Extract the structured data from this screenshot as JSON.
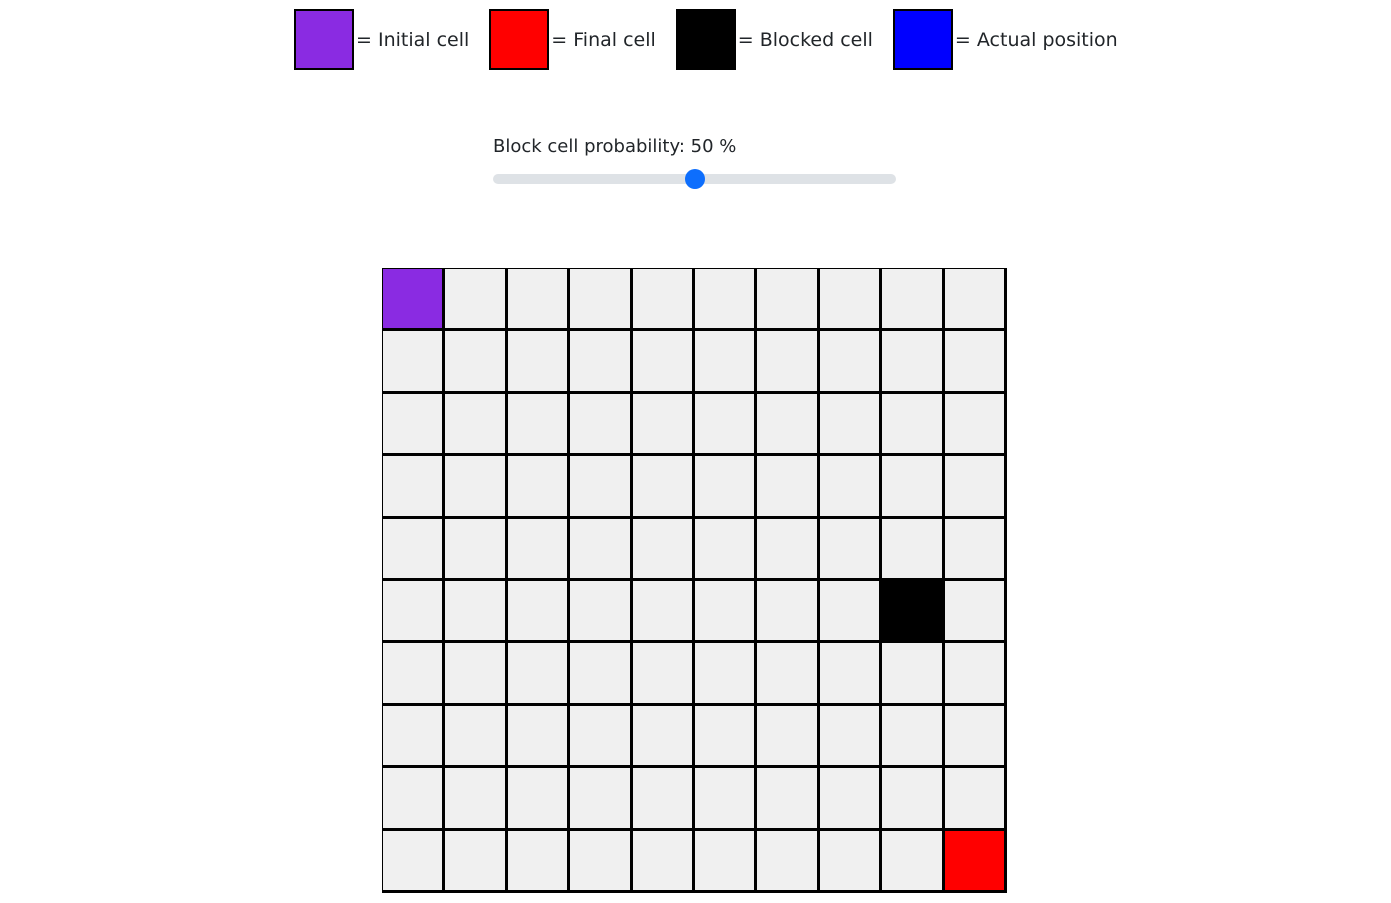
{
  "colors": {
    "initial": "#8a2be2",
    "final": "#ff0000",
    "blocked": "#000000",
    "actual": "#0000ff",
    "empty": "#f0f0f0",
    "slider_accent": "#0d6efd",
    "slider_track": "#dee2e6"
  },
  "legend": {
    "items": [
      {
        "key": "initial",
        "label": "= Initial cell"
      },
      {
        "key": "final",
        "label": "= Final cell"
      },
      {
        "key": "blocked",
        "label": "= Blocked cell"
      },
      {
        "key": "actual",
        "label": "= Actual position"
      }
    ]
  },
  "slider": {
    "label": "Block cell probability: 50 %",
    "value": 50,
    "min": 0,
    "max": 100
  },
  "grid": {
    "rows": 10,
    "cols": 10,
    "special_cells": [
      {
        "row": 0,
        "col": 0,
        "type": "initial"
      },
      {
        "row": 5,
        "col": 8,
        "type": "blocked"
      },
      {
        "row": 9,
        "col": 9,
        "type": "final"
      }
    ]
  }
}
